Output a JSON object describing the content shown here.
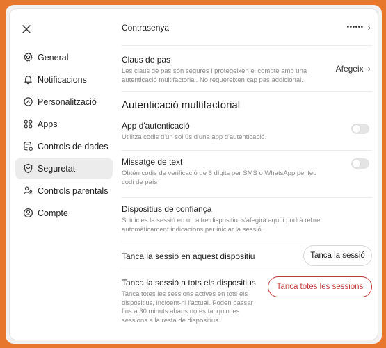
{
  "colors": {
    "frame_accent": "#e8772e",
    "danger": "#c13a3a",
    "active_nav_bg": "#ececec"
  },
  "sidebar": {
    "close_icon": "close-icon",
    "items": [
      {
        "label": "General",
        "icon": "gear-icon"
      },
      {
        "label": "Notificacions",
        "icon": "bell-icon"
      },
      {
        "label": "Personalització",
        "icon": "palette-icon"
      },
      {
        "label": "Apps",
        "icon": "apps-grid-icon"
      },
      {
        "label": "Controls de dades",
        "icon": "database-icon"
      },
      {
        "label": "Seguretat",
        "icon": "shield-icon",
        "active": true
      },
      {
        "label": "Controls parentals",
        "icon": "parental-icon"
      },
      {
        "label": "Compte",
        "icon": "account-icon"
      }
    ]
  },
  "security": {
    "password": {
      "title": "Contrasenya",
      "value": "••••••"
    },
    "passkeys": {
      "title": "Claus de pas",
      "desc": "Les claus de pas són segures i protegeixen el compte amb una autenticació multifactorial. No requereixen cap pas addicional.",
      "action": "Afegeix"
    },
    "mfa_heading": "Autenticació multifactorial",
    "auth_app": {
      "title": "App d'autenticació",
      "desc": "Utilitza codis d'un sol ús d'una app d'autenticació.",
      "enabled": false
    },
    "sms": {
      "title": "Missatge de text",
      "desc": "Obtén codis de verificació de 6 dígits per SMS o WhatsApp pel teu codi de país",
      "enabled": false
    },
    "trusted": {
      "title": "Dispositius de confiança",
      "desc": "Si inicies la sessió en un altre dispositiu, s'afegirà aquí i podrà rebre automàticament indicacions per iniciar la sessió."
    },
    "logout_this": {
      "title": "Tanca la sessió en aquest dispositiu",
      "button": "Tanca la sessió"
    },
    "logout_all": {
      "title": "Tanca la sessió a tots els dispositius",
      "desc": "Tanca totes les sessions actives en tots els dispositius, incloent-hi l'actual. Poden passar fins a 30 minuts abans no es tanquin les sessions a la resta de dispositius.",
      "button": "Tanca totes les sessions"
    }
  }
}
